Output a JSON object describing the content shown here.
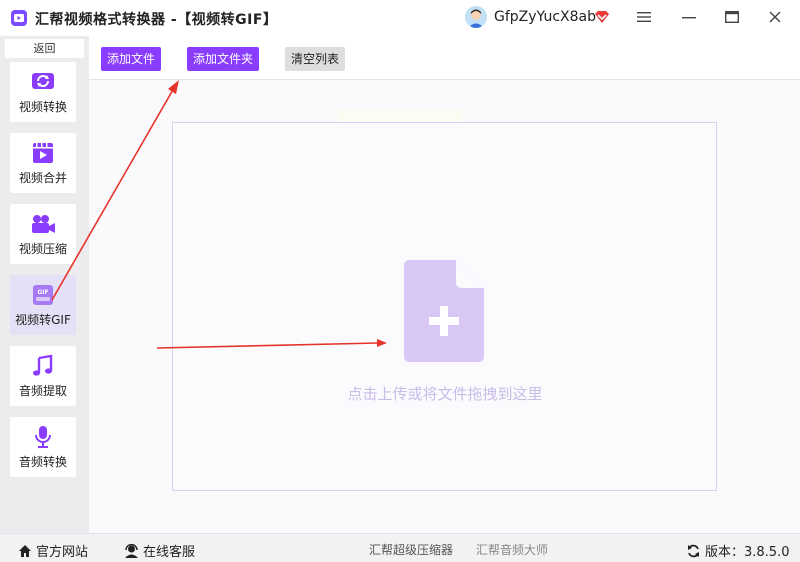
{
  "window": {
    "title": "汇帮视频格式转换器  -【视频转GIF】",
    "username": "GfpZyYucX8ab",
    "icons": [
      "app-logo-icon",
      "avatar",
      "vip-diamond-icon",
      "menu-icon",
      "minimize-icon",
      "maximize-icon",
      "close-icon"
    ]
  },
  "sidebar": {
    "back_label": "返回",
    "items": [
      {
        "label": "视频转换",
        "icon": "video-convert-icon"
      },
      {
        "label": "视频合并",
        "icon": "video-merge-icon"
      },
      {
        "label": "视频压缩",
        "icon": "video-compress-icon"
      },
      {
        "label": "视频转GIF",
        "icon": "gif-icon",
        "active": true
      },
      {
        "label": "音频提取",
        "icon": "music-note-icon"
      },
      {
        "label": "音频转换",
        "icon": "microphone-icon"
      }
    ]
  },
  "toolbar": {
    "add_file": "添加文件",
    "add_folder": "添加文件夹",
    "clear_list": "清空列表"
  },
  "dropzone": {
    "hint": "点击上传或将文件拖拽到这里",
    "icon": "file-add-icon"
  },
  "statusbar": {
    "website": "官方网站",
    "support": "在线客服",
    "compressor": "汇帮超级压缩器",
    "audio_master": "汇帮音频大师",
    "version": "版本：3.8.5.0"
  },
  "colors": {
    "accent": "#8a3dff",
    "annotation": "#e5332a",
    "dropzone_border": "#d8d2f0"
  }
}
